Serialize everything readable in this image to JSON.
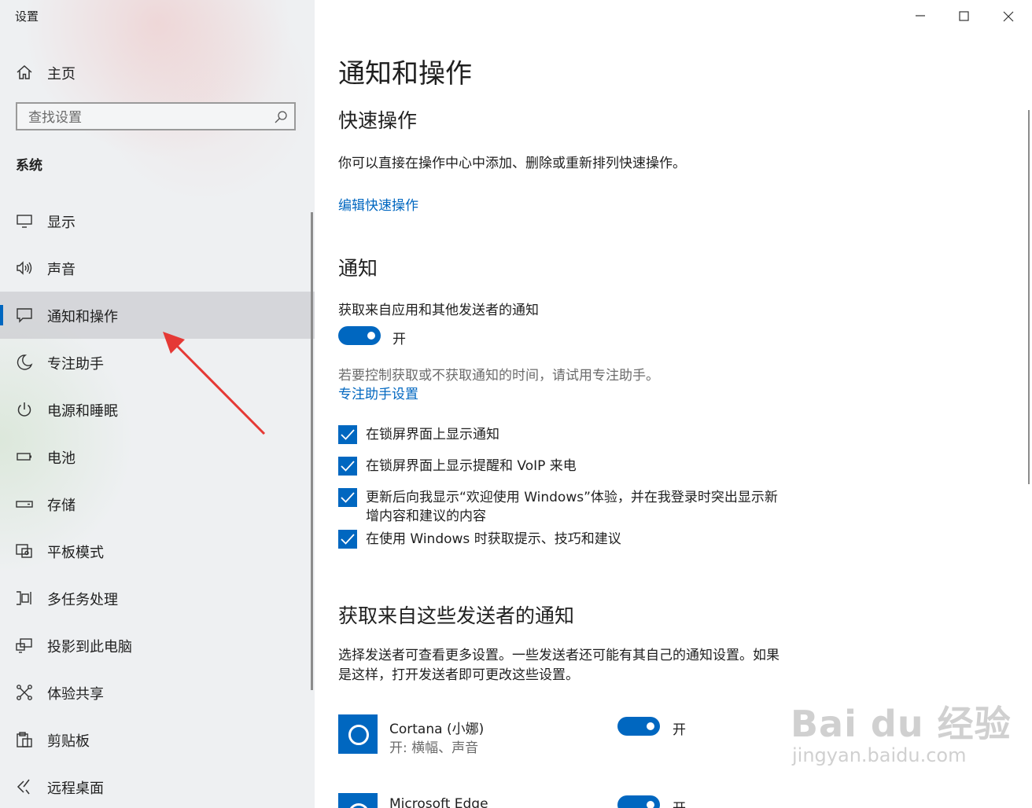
{
  "app": {
    "title": "设置"
  },
  "sidebar": {
    "home_label": "主页",
    "search_placeholder": "查找设置",
    "section_title": "系统",
    "items": [
      {
        "label": "显示",
        "icon": "monitor-icon"
      },
      {
        "label": "声音",
        "icon": "speaker-icon"
      },
      {
        "label": "通知和操作",
        "icon": "notification-icon",
        "active": true
      },
      {
        "label": "专注助手",
        "icon": "moon-icon"
      },
      {
        "label": "电源和睡眠",
        "icon": "power-icon"
      },
      {
        "label": "电池",
        "icon": "battery-icon"
      },
      {
        "label": "存储",
        "icon": "storage-icon"
      },
      {
        "label": "平板模式",
        "icon": "tablet-mode-icon"
      },
      {
        "label": "多任务处理",
        "icon": "multitasking-icon"
      },
      {
        "label": "投影到此电脑",
        "icon": "project-icon"
      },
      {
        "label": "体验共享",
        "icon": "share-icon"
      },
      {
        "label": "剪贴板",
        "icon": "clipboard-icon"
      },
      {
        "label": "远程桌面",
        "icon": "remote-desktop-icon"
      }
    ]
  },
  "main": {
    "title": "通知和操作",
    "quick_actions": {
      "heading": "快速操作",
      "description": "你可以直接在操作中心中添加、删除或重新排列快速操作。",
      "edit_link": "编辑快速操作"
    },
    "notifications": {
      "heading": "通知",
      "get_notifications_label": "获取来自应用和其他发送者的通知",
      "toggle_state": "开",
      "focus_hint": "若要控制获取或不获取通知的时间，请试用专注助手。",
      "focus_link": "专注助手设置",
      "checkboxes": [
        {
          "label": "在锁屏界面上显示通知",
          "checked": true
        },
        {
          "label": "在锁屏界面上显示提醒和 VoIP 来电",
          "checked": true
        },
        {
          "label": "更新后向我显示“欢迎使用 Windows”体验，并在我登录时突出显示新增内容和建议的内容",
          "checked": true
        },
        {
          "label": "在使用 Windows 时获取提示、技巧和建议",
          "checked": true
        }
      ]
    },
    "senders": {
      "heading": "获取来自这些发送者的通知",
      "description": "选择发送者可查看更多设置。一些发送者还可能有其自己的通知设置。如果是这样，打开发送者即可更改这些设置。",
      "apps": [
        {
          "name": "Cortana (小娜)",
          "detail": "开: 横幅、声音",
          "toggle_state": "开"
        },
        {
          "name": "Microsoft Edge",
          "detail": "",
          "toggle_state": "开"
        }
      ]
    }
  },
  "watermark": {
    "main": "Bai du 经验",
    "sub": "jingyan.baidu.com"
  },
  "colors": {
    "accent": "#0067c0",
    "arrow": "#e53935"
  }
}
